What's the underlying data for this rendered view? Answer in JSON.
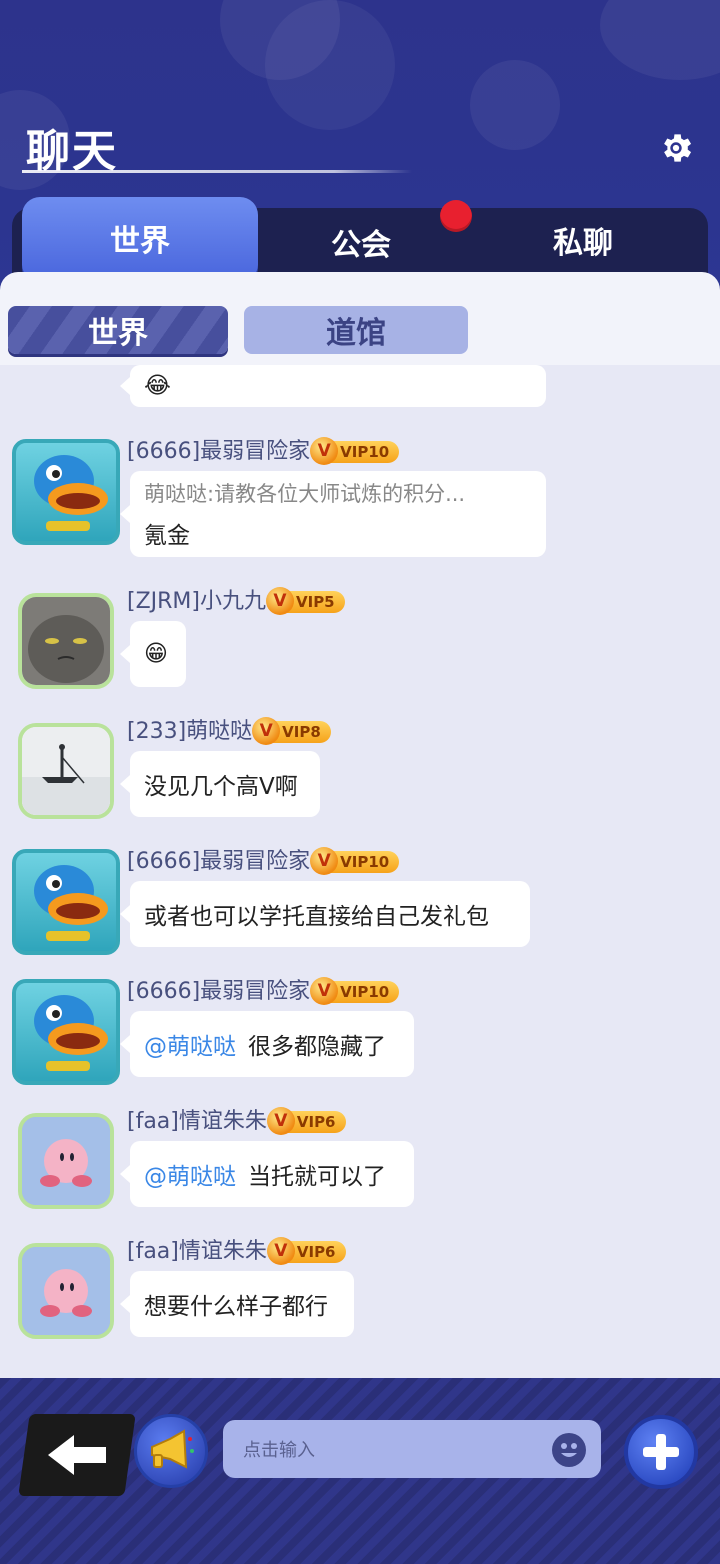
{
  "header": {
    "title": "聊天",
    "settings_icon": "gear-icon"
  },
  "tabs": [
    {
      "label": "世界",
      "active": true
    },
    {
      "label": "公会",
      "active": false,
      "badge": "red-dot"
    },
    {
      "label": "私聊",
      "active": false
    }
  ],
  "subtabs": [
    {
      "label": "世界",
      "active": true
    },
    {
      "label": "道馆",
      "active": false
    }
  ],
  "messages": [
    {
      "user": "",
      "vip": "",
      "text": "😂",
      "avatar": "frog-icon",
      "partial": true
    },
    {
      "user": "[6666]最弱冒险家",
      "vip": "VIP10",
      "quote": "萌哒哒:请教各位大师试炼的积分...",
      "text": "氪金",
      "avatar": "duck-icon"
    },
    {
      "user": "[ZJRM]小九九",
      "vip": "VIP5",
      "text": "😁",
      "avatar": "cat-photo"
    },
    {
      "user": "[233]萌哒哒",
      "vip": "VIP8",
      "text": "没见几个高V啊",
      "avatar": "boat-photo"
    },
    {
      "user": "[6666]最弱冒险家",
      "vip": "VIP10",
      "text": "或者也可以学托直接给自己发礼包",
      "avatar": "duck-icon"
    },
    {
      "user": "[6666]最弱冒险家",
      "vip": "VIP10",
      "mention": "@萌哒哒",
      "text": "很多都隐藏了",
      "avatar": "duck-icon"
    },
    {
      "user": "[faa]情谊朱朱",
      "vip": "VIP6",
      "mention": "@萌哒哒",
      "text": "当托就可以了",
      "avatar": "kirby-icon"
    },
    {
      "user": "[faa]情谊朱朱",
      "vip": "VIP6",
      "text": "想要什么样子都行",
      "avatar": "kirby-icon"
    }
  ],
  "bottom": {
    "input_placeholder": "点击输入",
    "back_icon": "back-arrow-icon",
    "horn_icon": "megaphone-icon",
    "emoji_icon": "smiley-icon",
    "plus_icon": "plus-icon"
  },
  "colors": {
    "header_bg": "#2d338c",
    "tab_active": "#4a66dd",
    "vip_badge": "#f6a21a",
    "mention": "#3a87e6",
    "red_dot": "#e8202f"
  }
}
